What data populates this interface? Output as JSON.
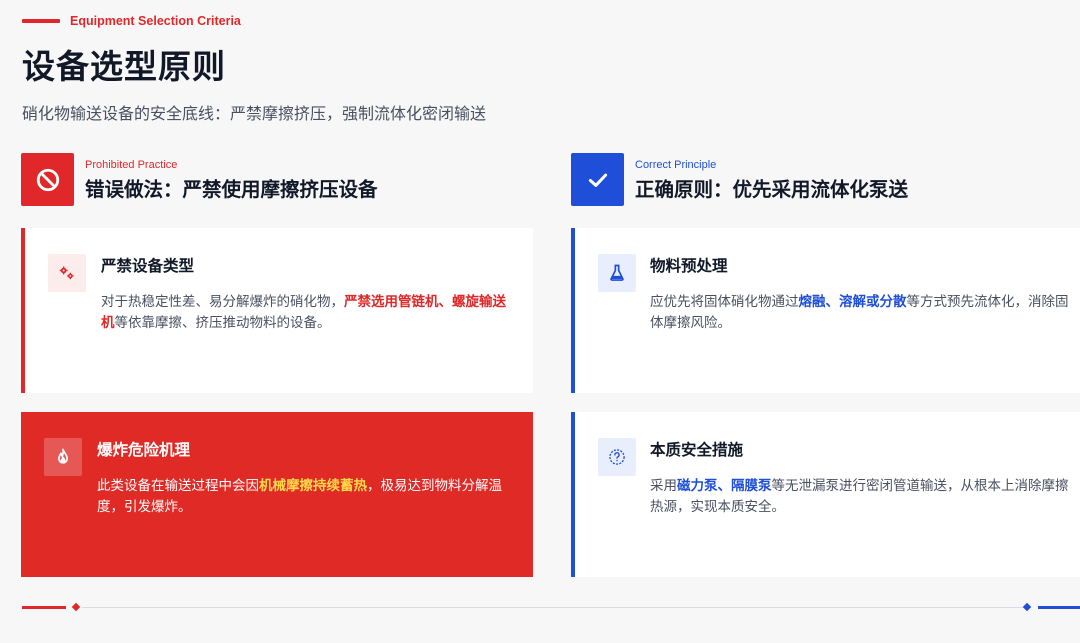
{
  "header": {
    "eyebrow": "Equipment Selection Criteria",
    "title": "设备选型原则",
    "subtitle": "硝化物输送设备的安全底线：严禁摩擦挤压，强制流体化密闭输送"
  },
  "left": {
    "label_en": "Prohibited Practice",
    "label_zh": "错误做法：严禁使用摩擦挤压设备",
    "icon": "prohibited-icon",
    "accent": "#e0282a",
    "card1": {
      "icon": "gears-icon",
      "title": "严禁设备类型",
      "body_pre": "对于热稳定性差、易分解爆炸的硝化物，",
      "body_highlight": "严禁选用管链机、螺旋输送机",
      "body_post": "等依靠摩擦、挤压推动物料的设备。"
    },
    "card2": {
      "icon": "fire-icon",
      "title": "爆炸危险机理",
      "body_pre": "此类设备在输送过程中会因",
      "body_highlight": "机械摩擦持续蓄热",
      "body_post": "，极易达到物料分解温度，引发爆炸。",
      "background": "#df2a26"
    }
  },
  "right": {
    "label_en": "Correct Principle",
    "label_zh": "正确原则：优先采用流体化泵送",
    "icon": "check-icon",
    "accent": "#1f4fd8",
    "card1": {
      "icon": "flask-icon",
      "title": "物料预处理",
      "body_pre": "应优先将固体硝化物通过",
      "body_hl1": "熔融",
      "body_sep": "、",
      "body_hl2": "溶解或分散",
      "body_post": "等方式预先流体化，消除固体摩擦风险。"
    },
    "card2": {
      "icon": "question-icon",
      "title": "本质安全措施",
      "body_pre": "采用",
      "body_hl1": "磁力泵",
      "body_sep": "、",
      "body_hl2": "隔膜泵",
      "body_post": "等无泄漏泵进行密闭管道输送，从根本上消除摩擦热源，实现本质安全。"
    }
  }
}
